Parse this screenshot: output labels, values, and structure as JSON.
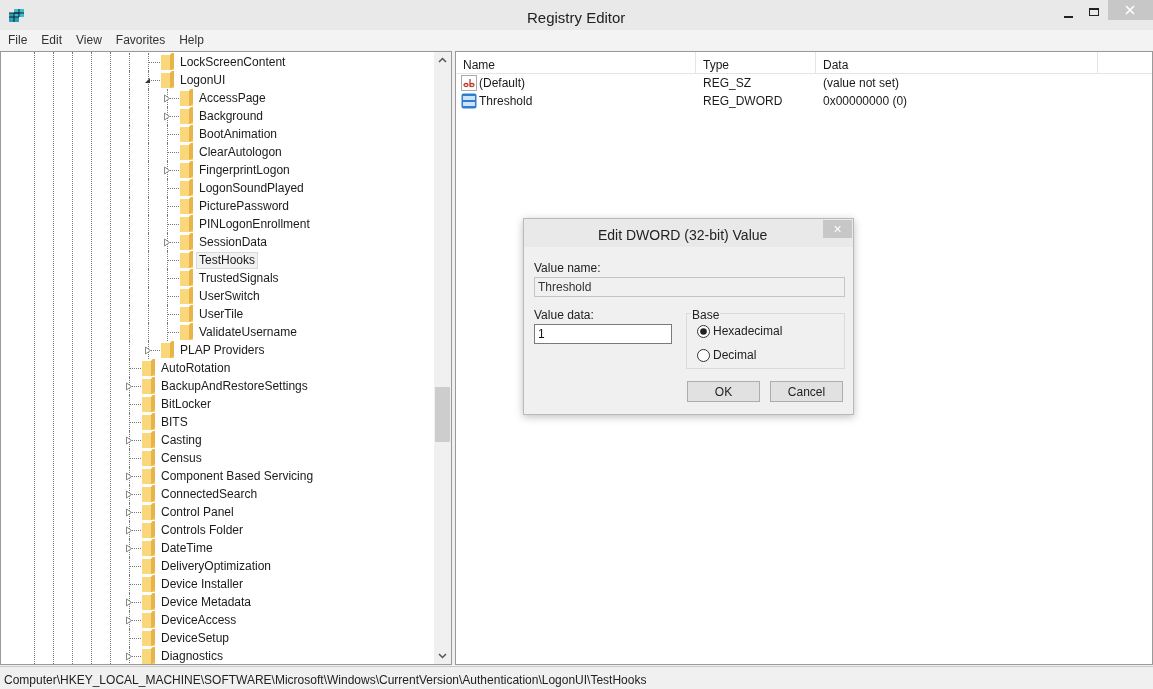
{
  "window": {
    "title": "Registry Editor"
  },
  "menu": [
    "File",
    "Edit",
    "View",
    "Favorites",
    "Help"
  ],
  "tree": {
    "partial_branch": [
      {
        "label": "LockScreenContent",
        "kind": "leaf",
        "selected": false
      },
      {
        "label": "LogonUI",
        "kind": "expanded",
        "selected": false,
        "children": [
          {
            "label": "AccessPage",
            "kind": "collapsed",
            "selected": false
          },
          {
            "label": "Background",
            "kind": "collapsed",
            "selected": false
          },
          {
            "label": "BootAnimation",
            "kind": "leaf",
            "selected": false
          },
          {
            "label": "ClearAutologon",
            "kind": "leaf",
            "selected": false
          },
          {
            "label": "FingerprintLogon",
            "kind": "collapsed",
            "selected": false
          },
          {
            "label": "LogonSoundPlayed",
            "kind": "leaf",
            "selected": false
          },
          {
            "label": "PicturePassword",
            "kind": "leaf",
            "selected": false
          },
          {
            "label": "PINLogonEnrollment",
            "kind": "leaf",
            "selected": false
          },
          {
            "label": "SessionData",
            "kind": "collapsed",
            "selected": false
          },
          {
            "label": "TestHooks",
            "kind": "leaf",
            "selected": true
          },
          {
            "label": "TrustedSignals",
            "kind": "leaf",
            "selected": false
          },
          {
            "label": "UserSwitch",
            "kind": "leaf",
            "selected": false
          },
          {
            "label": "UserTile",
            "kind": "leaf",
            "selected": false
          },
          {
            "label": "ValidateUsername",
            "kind": "leaf",
            "selected": false
          }
        ]
      },
      {
        "label": "PLAP Providers",
        "kind": "collapsed",
        "selected": false
      }
    ],
    "items": [
      {
        "label": "AutoRotation",
        "kind": "leaf",
        "selected": false
      },
      {
        "label": "BackupAndRestoreSettings",
        "kind": "collapsed",
        "selected": false
      },
      {
        "label": "BitLocker",
        "kind": "leaf",
        "selected": false
      },
      {
        "label": "BITS",
        "kind": "leaf",
        "selected": false
      },
      {
        "label": "Casting",
        "kind": "collapsed",
        "selected": false
      },
      {
        "label": "Census",
        "kind": "leaf",
        "selected": false
      },
      {
        "label": "Component Based Servicing",
        "kind": "collapsed",
        "selected": false
      },
      {
        "label": "ConnectedSearch",
        "kind": "collapsed",
        "selected": false
      },
      {
        "label": "Control Panel",
        "kind": "collapsed",
        "selected": false
      },
      {
        "label": "Controls Folder",
        "kind": "collapsed",
        "selected": false
      },
      {
        "label": "DateTime",
        "kind": "collapsed",
        "selected": false
      },
      {
        "label": "DeliveryOptimization",
        "kind": "leaf",
        "selected": false
      },
      {
        "label": "Device Installer",
        "kind": "leaf",
        "selected": false
      },
      {
        "label": "Device Metadata",
        "kind": "collapsed",
        "selected": false
      },
      {
        "label": "DeviceAccess",
        "kind": "collapsed",
        "selected": false
      },
      {
        "label": "DeviceSetup",
        "kind": "leaf",
        "selected": false
      },
      {
        "label": "Diagnostics",
        "kind": "collapsed",
        "selected": false
      }
    ]
  },
  "values": {
    "columns": [
      "Name",
      "Type",
      "Data"
    ],
    "rows": [
      {
        "kind": "string",
        "name": "(Default)",
        "type": "REG_SZ",
        "data": "(value not set)"
      },
      {
        "kind": "dword",
        "name": "Threshold",
        "type": "REG_DWORD",
        "data": "0x00000000 (0)"
      }
    ]
  },
  "dialog": {
    "title": "Edit DWORD (32-bit) Value",
    "close": "×",
    "value_name_label": "Value name:",
    "value_name": {
      "value": "Threshold",
      "read_only": true
    },
    "value_data_label": "Value data:",
    "value_data": {
      "value": "1",
      "read_only": false
    },
    "base_label": "Base",
    "base_options": [
      {
        "label": "Hexadecimal",
        "selected": true
      },
      {
        "label": "Decimal",
        "selected": false
      }
    ],
    "buttons": [
      "OK",
      "Cancel"
    ]
  },
  "status_bar": "Computer\\HKEY_LOCAL_MACHINE\\SOFTWARE\\Microsoft\\Windows\\CurrentVersion\\Authentication\\LogonUI\\TestHooks"
}
